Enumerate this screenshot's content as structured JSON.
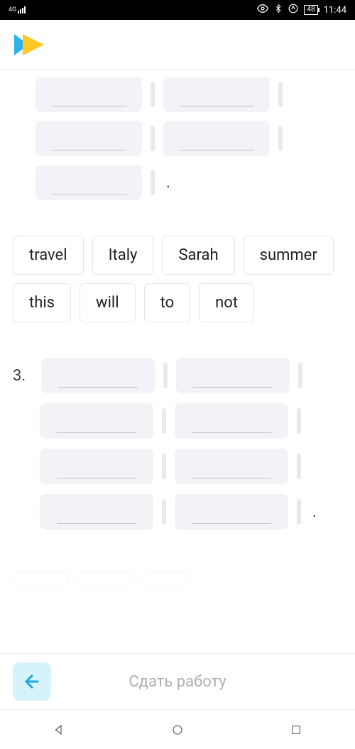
{
  "status": {
    "network": "4G",
    "battery": "48",
    "time": "11:44"
  },
  "word_bank": [
    "travel",
    "Italy",
    "Sarah",
    "summer",
    "this",
    "will",
    "to",
    "not"
  ],
  "question_number": "3.",
  "bottom": {
    "submit_label": "Сдать работу"
  }
}
